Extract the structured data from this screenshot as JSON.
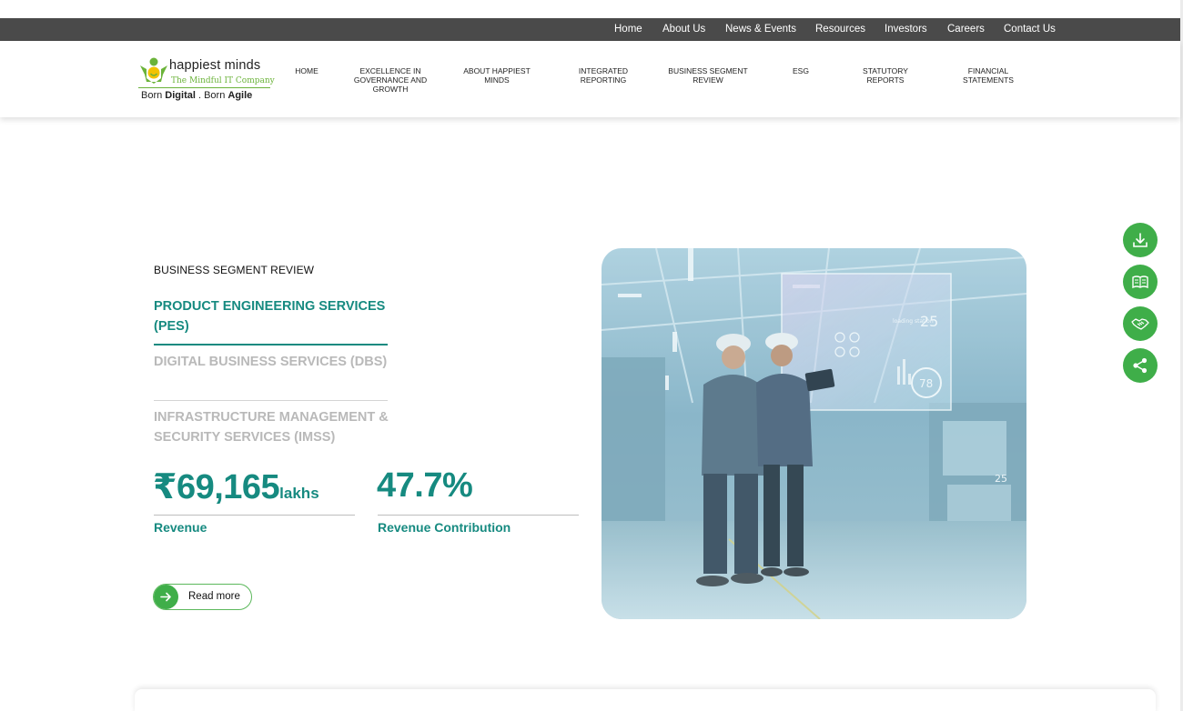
{
  "topbar": {
    "links": [
      "Home",
      "About Us",
      "News & Events",
      "Resources",
      "Investors",
      "Careers",
      "Contact Us"
    ]
  },
  "logo": {
    "brand": "happiest minds",
    "tagline": "The Mindful IT Company",
    "slogan_born1": "Born ",
    "slogan_digital": "Digital",
    "slogan_sep": " . Born ",
    "slogan_agile": "Agile",
    "colors": {
      "green": "#6bb33a",
      "yellow": "#f2c200"
    }
  },
  "nav": {
    "items": [
      {
        "label": "HOME"
      },
      {
        "label": "EXCELLENCE IN GOVERNANCE AND GROWTH"
      },
      {
        "label": "ABOUT HAPPIEST MINDS"
      },
      {
        "label": "INTEGRATED REPORTING"
      },
      {
        "label": "BUSINESS SEGMENT REVIEW"
      },
      {
        "label": "ESG"
      },
      {
        "label": "STATUTORY REPORTS"
      },
      {
        "label": "FINANCIAL STATEMENTS"
      }
    ]
  },
  "section": {
    "eyebrow": "BUSINESS SEGMENT REVIEW",
    "segments": [
      {
        "label": "PRODUCT ENGINEERING SERVICES (PES)",
        "active": true
      },
      {
        "label": "DIGITAL BUSINESS SERVICES (DBS)",
        "active": false
      },
      {
        "label": "INFRASTRUCTURE MANAGEMENT & SECURITY SERVICES (IMSS)",
        "active": false
      }
    ],
    "stats": [
      {
        "value": "₹69,165",
        "unit": "lakhs",
        "label": "Revenue"
      },
      {
        "value": "47.7%",
        "unit": "",
        "label": "Revenue Contribution"
      }
    ],
    "read_more": "Read more"
  },
  "hero": {
    "hud_value_1": "25",
    "hud_caption": "loading station",
    "hud_value_2": "78",
    "hud_value_3": "25"
  },
  "floating": {
    "icons": [
      "download-icon",
      "book-icon",
      "handshake-icon",
      "share-icon"
    ]
  },
  "theme": {
    "teal": "#168a80",
    "green": "#3fae49",
    "topbar": "#4a4a4a",
    "inactive": "#b9b9b9"
  }
}
